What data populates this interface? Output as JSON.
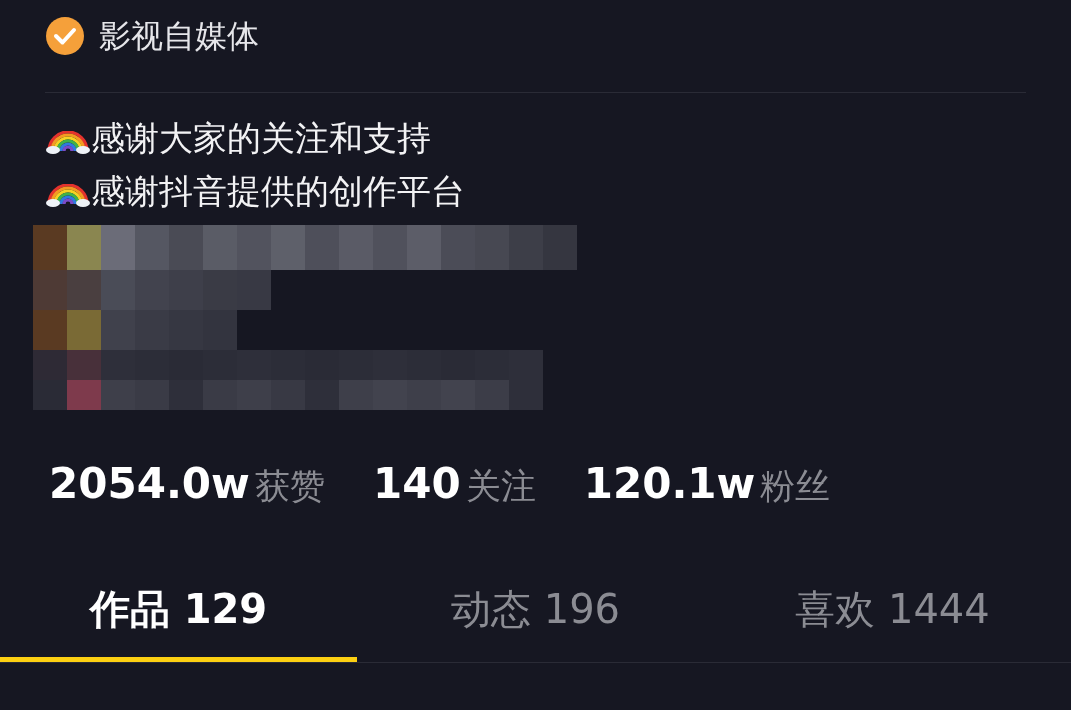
{
  "account": {
    "verified": true,
    "label": "影视自媒体"
  },
  "bio": [
    {
      "text": "感谢大家的关注和支持"
    },
    {
      "text": "感谢抖音提供的创作平台"
    }
  ],
  "stats": [
    {
      "count": "2054.0w",
      "caption": "获赞"
    },
    {
      "count": "140",
      "caption": "关注"
    },
    {
      "count": "120.1w",
      "caption": "粉丝"
    }
  ],
  "tabs": [
    {
      "label": "作品 129",
      "selected": true
    },
    {
      "label": "动态 196",
      "selected": false
    },
    {
      "label": "喜欢 1444",
      "selected": false
    }
  ]
}
